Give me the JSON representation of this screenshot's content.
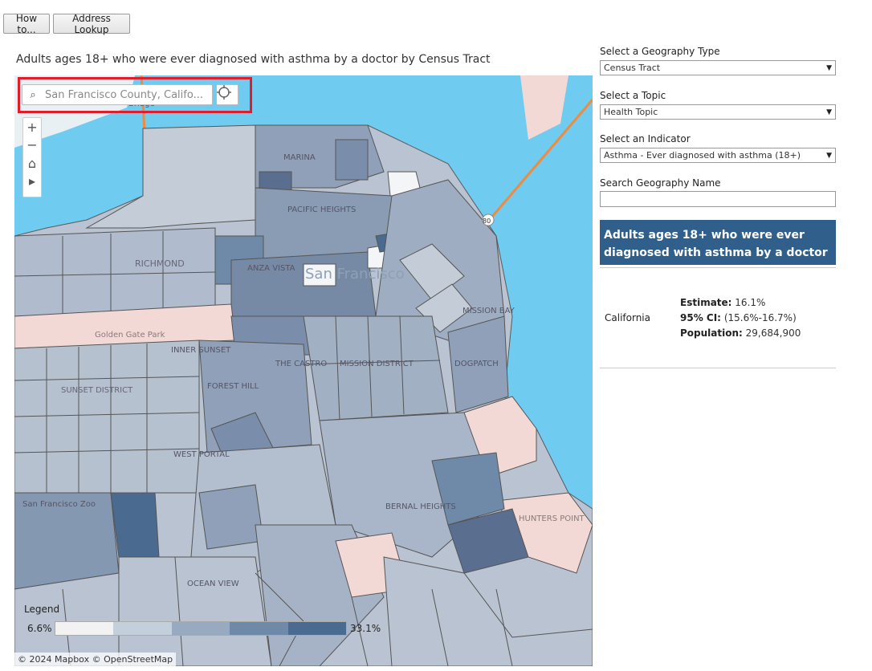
{
  "toolbar": {
    "how_to_label": "How to...",
    "address_lookup_label": "Address Lookup"
  },
  "map": {
    "title": "Adults ages 18+ who were ever diagnosed with asthma by a doctor by Census Tract",
    "search_value": "San Francisco County, Califo...",
    "zoom_controls": [
      "+",
      "−",
      "⌂",
      "▸"
    ],
    "labels": [
      "Bridge",
      "MARINA",
      "PACIFIC HEIGHTS",
      "RICHMOND",
      "ANZA VISTA",
      "San Francisco",
      "Golden Gate Park",
      "MISSION BAY",
      "SUNSET DISTRICT",
      "INNER SUNSET",
      "THE CASTRO",
      "MISSION DISTRICT",
      "DOGPATCH",
      "FOREST HILL",
      "WEST PORTAL",
      "San Francisco Zoo",
      "BERNAL HEIGHTS",
      "HUNTERS POINT",
      "OCEAN VIEW",
      "80"
    ],
    "legend": {
      "title": "Legend",
      "min": "6.6%",
      "max": "33.1%",
      "colors": [
        "#f2f2f2",
        "#c3cfdb",
        "#97aac0",
        "#6e8aa8",
        "#4a6a8f"
      ]
    },
    "attribution": "© 2024 Mapbox © OpenStreetMap",
    "colors": {
      "water": "#6fcbef",
      "land_low": "#f2d9d6",
      "tract_light": "#c4ccd8",
      "tract_mid": "#a2b0c4",
      "tract_dark": "#7a8eab",
      "tract_darkest": "#5a6e8f",
      "tract_white": "#f4f5f7",
      "highway": "#f08a3c",
      "highlight": "#e01e2b"
    }
  },
  "panel": {
    "geography_type_label": "Select a Geography Type",
    "geography_type_value": "Census Tract",
    "topic_label": "Select a Topic",
    "topic_value": "Health Topic",
    "indicator_label": "Select an Indicator",
    "indicator_value": "Asthma - Ever diagnosed with asthma (18+)",
    "search_label": "Search Geography Name",
    "search_value": "",
    "indicator_heading": "Adults ages 18+ who were ever diagnosed with asthma by a doctor",
    "stats": {
      "place": "California",
      "estimate_label": "Estimate:",
      "estimate_value": "16.1%",
      "ci_label": "95% CI:",
      "ci_value": "(15.6%-16.7%)",
      "population_label": "Population:",
      "population_value": "29,684,900"
    }
  }
}
